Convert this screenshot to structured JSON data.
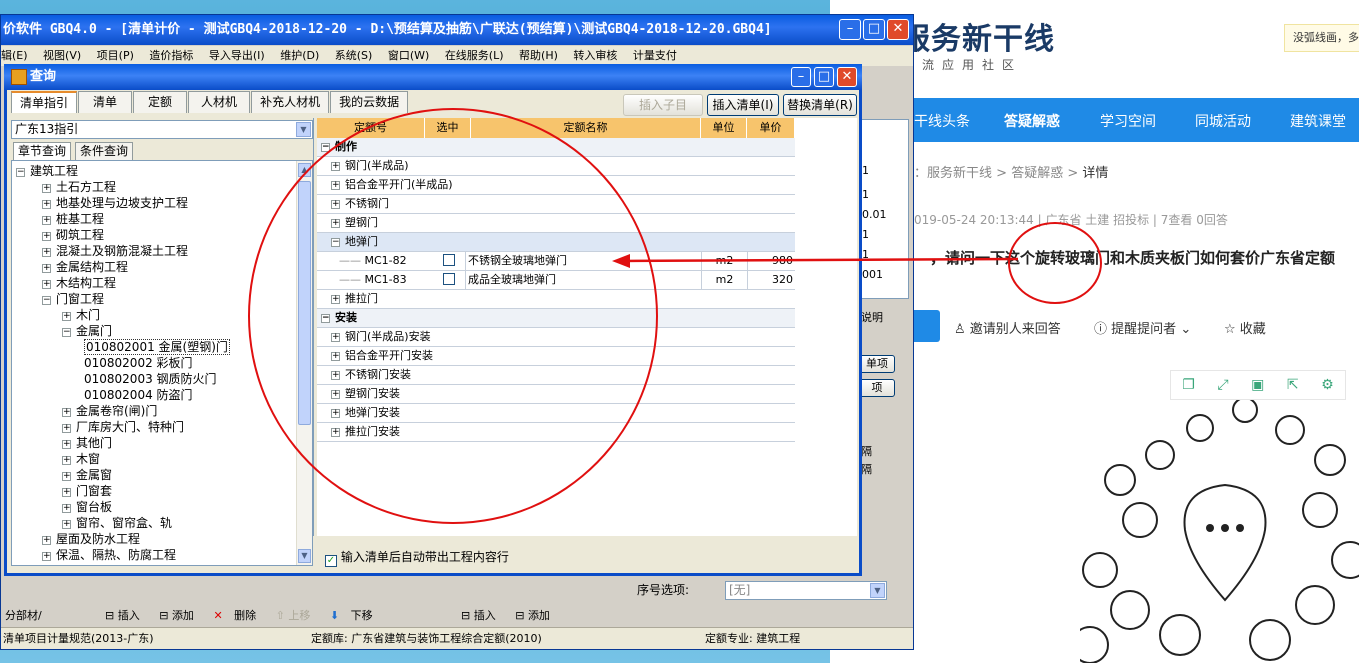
{
  "web": {
    "brand": "服务新干线",
    "brand_sub": "交流应用社区",
    "notice": "没弧线画，多",
    "nav": [
      "干线头条",
      "答疑解惑",
      "学习空间",
      "同城活动",
      "建筑课堂"
    ],
    "breadcrumb": [
      "服务新干线",
      "答疑解惑",
      "详情"
    ],
    "meta": "019-05-24 20:13:44   |   广东省  土建 招投标   |   7查看  0回答",
    "question": "，请问一下这个旋转玻璃门和木质夹板门如何套价广东省定额",
    "actions": [
      "邀请别人来回答",
      "提醒提问者",
      "收藏"
    ]
  },
  "app": {
    "title": "价软件 GBQ4.0 - [清单计价 - 测试GBQ4-2018-12-20 - D:\\预结算及抽筋\\广联达(预结算)\\测试GBQ4-2018-12-20.GBQ4]",
    "menu": [
      "辑(E)",
      "视图(V)",
      "项目(P)",
      "造价指标",
      "导入导出(I)",
      "维护(D)",
      "系统(S)",
      "窗口(W)",
      "在线服务(L)",
      "帮助(H)",
      "转入审核",
      "计量支付"
    ],
    "status": [
      "清单项目计量规范(2013-广东)",
      "定额库: 广东省建筑与装饰工程综合定额(2010)",
      "定额专业: 建筑工程"
    ],
    "bottom_left": [
      "分部材/"
    ],
    "bottom_toolbar": [
      "插入",
      "添加",
      "删除",
      "上移",
      "下移"
    ],
    "bottom_toolbar2": [
      "插入",
      "添加"
    ],
    "seq_label": "序号选项:",
    "seq_value": "[无]",
    "bg_values": [
      "1",
      "1",
      "0.01",
      "1",
      "1",
      "001"
    ],
    "bg_buttons": [
      "单项",
      "项"
    ],
    "bg_texts": [
      "说明",
      "隔",
      "隔"
    ]
  },
  "dialog": {
    "title": "查询",
    "tabs": [
      "清单指引",
      "清单",
      "定额",
      "人材机",
      "补充人材机",
      "我的云数据"
    ],
    "buttons": {
      "insert_child": "插入子目",
      "insert_list": "插入清单(I)",
      "replace_list": "替换清单(R)"
    },
    "guide_select": "广东13指引",
    "subtabs": [
      "章节查询",
      "条件查询"
    ],
    "tree": [
      {
        "label": "建筑工程",
        "level": 0,
        "pm": "−"
      },
      {
        "label": "土石方工程",
        "level": 1,
        "pm": "+"
      },
      {
        "label": "地基处理与边坡支护工程",
        "level": 1,
        "pm": "+"
      },
      {
        "label": "桩基工程",
        "level": 1,
        "pm": "+"
      },
      {
        "label": "砌筑工程",
        "level": 1,
        "pm": "+"
      },
      {
        "label": "混凝土及钢筋混凝土工程",
        "level": 1,
        "pm": "+"
      },
      {
        "label": "金属结构工程",
        "level": 1,
        "pm": "+"
      },
      {
        "label": "木结构工程",
        "level": 1,
        "pm": "+"
      },
      {
        "label": "门窗工程",
        "level": 1,
        "pm": "−"
      },
      {
        "label": "木门",
        "level": 2,
        "pm": "+"
      },
      {
        "label": "金属门",
        "level": 2,
        "pm": "−"
      },
      {
        "label": "010802001  金属(塑钢)门",
        "level": 3,
        "pm": ""
      },
      {
        "label": "010802002  彩板门",
        "level": 3,
        "pm": ""
      },
      {
        "label": "010802003  钢质防火门",
        "level": 3,
        "pm": ""
      },
      {
        "label": "010802004  防盗门",
        "level": 3,
        "pm": ""
      },
      {
        "label": "金属卷帘(闸)门",
        "level": 2,
        "pm": "+"
      },
      {
        "label": "厂库房大门、特种门",
        "level": 2,
        "pm": "+"
      },
      {
        "label": "其他门",
        "level": 2,
        "pm": "+"
      },
      {
        "label": "木窗",
        "level": 2,
        "pm": "+"
      },
      {
        "label": "金属窗",
        "level": 2,
        "pm": "+"
      },
      {
        "label": "门窗套",
        "level": 2,
        "pm": "+"
      },
      {
        "label": "窗台板",
        "level": 2,
        "pm": "+"
      },
      {
        "label": "窗帘、窗帘盒、轨",
        "level": 2,
        "pm": "+"
      },
      {
        "label": "屋面及防水工程",
        "level": 1,
        "pm": "+"
      },
      {
        "label": "保温、隔热、防腐工程",
        "level": 1,
        "pm": "+"
      }
    ],
    "columns": [
      "定额号",
      "选中",
      "定额名称",
      "单位",
      "单价"
    ],
    "rows": [
      {
        "type": "grp",
        "pm": "−",
        "name": "制作"
      },
      {
        "type": "sub",
        "pm": "+",
        "name": "钢门(半成品)"
      },
      {
        "type": "sub",
        "pm": "+",
        "name": "铝合金平开门(半成品)"
      },
      {
        "type": "sub",
        "pm": "+",
        "name": "不锈钢门"
      },
      {
        "type": "sub",
        "pm": "+",
        "name": "塑钢门"
      },
      {
        "type": "sub",
        "pm": "−",
        "name": "地弹门",
        "sel": true
      },
      {
        "type": "item",
        "code": "MC1-82",
        "name": "不锈钢全玻璃地弹门",
        "unit": "m2",
        "price": "980"
      },
      {
        "type": "item",
        "code": "MC1-83",
        "name": "成品全玻璃地弹门",
        "unit": "m2",
        "price": "320"
      },
      {
        "type": "sub",
        "pm": "+",
        "name": "推拉门"
      },
      {
        "type": "grp",
        "pm": "−",
        "name": "安装"
      },
      {
        "type": "sub",
        "pm": "+",
        "name": "钢门(半成品)安装"
      },
      {
        "type": "sub",
        "pm": "+",
        "name": "铝合金平开门安装"
      },
      {
        "type": "sub",
        "pm": "+",
        "name": "不锈钢门安装"
      },
      {
        "type": "sub",
        "pm": "+",
        "name": "塑钢门安装"
      },
      {
        "type": "sub",
        "pm": "+",
        "name": "地弹门安装"
      },
      {
        "type": "sub",
        "pm": "+",
        "name": "推拉门安装"
      }
    ],
    "auto_check": "输入清单后自动带出工程内容行"
  },
  "colors": {
    "accent": "#1f8ae6",
    "xp_title": "#0a4cc8",
    "annotation": "#e01010",
    "header": "#f7c46c"
  }
}
